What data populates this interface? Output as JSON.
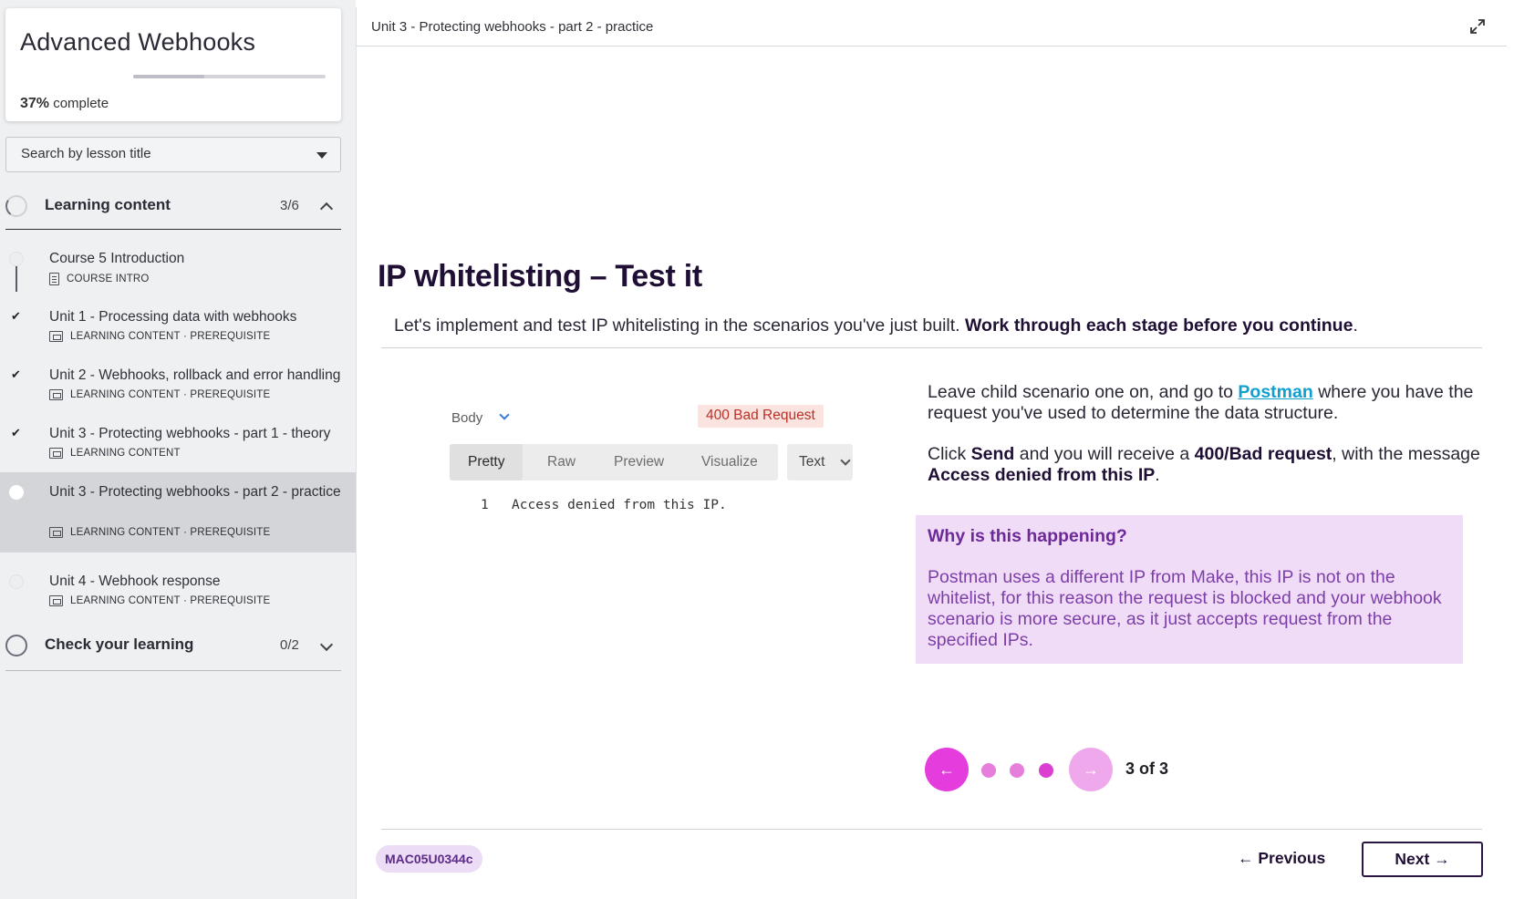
{
  "sidebar": {
    "course_title": "Advanced Webhooks",
    "progress_percent": "37%",
    "progress_suffix": "complete",
    "progress_fraction": 0.37,
    "search_placeholder": "Search by lesson title",
    "sections": [
      {
        "title": "Learning content",
        "count": "3/6",
        "expanded": true
      },
      {
        "title": "Check your learning",
        "count": "0/2",
        "expanded": false
      }
    ],
    "lessons": [
      {
        "title": "Course 5 Introduction",
        "meta": "COURSE INTRO",
        "done": false
      },
      {
        "title": "Unit 1 - Processing data with webhooks",
        "meta": "LEARNING CONTENT · PREREQUISITE",
        "done": true
      },
      {
        "title": "Unit 2 - Webhooks, rollback and error handling",
        "meta": "LEARNING CONTENT · PREREQUISITE",
        "done": true
      },
      {
        "title": "Unit 3 - Protecting webhooks - part 1 - theory",
        "meta": "LEARNING CONTENT",
        "done": true
      },
      {
        "title": "Unit 3 - Protecting webhooks - part 2 - practice",
        "meta": "LEARNING CONTENT · PREREQUISITE",
        "done": false,
        "active": true
      },
      {
        "title": "Unit 4 - Webhook response",
        "meta": "LEARNING CONTENT · PREREQUISITE",
        "done": false
      }
    ],
    "check_icon": "✔"
  },
  "main": {
    "header_title": "Unit 3 - Protecting webhooks - part 2 - practice",
    "slide_title": "IP whitelisting – Test it",
    "intro_plain": "Let's implement and test IP whitelisting in the scenarios you've just built. ",
    "intro_bold": "Work through each stage before you continue",
    "intro_end": ".",
    "postman": {
      "body_label": "Body",
      "status": "400 Bad Request",
      "tabs": [
        "Pretty",
        "Raw",
        "Preview",
        "Visualize"
      ],
      "type": "Text",
      "line_num": "1",
      "line_text": "Access denied from this IP."
    },
    "para1_a": "Leave child scenario one on, and go to ",
    "para1_link": "Postman",
    "para1_b": " where you have the request you've used to determine the data structure.",
    "para2_a": "Click ",
    "para2_send": "Send",
    "para2_b": " and you will receive a ",
    "para2_status": "400/Bad request",
    "para2_c": ", with the message ",
    "para2_msg": "Access denied from this IP",
    "para2_end": ".",
    "callout_title": "Why is this happening?",
    "callout_body": "Postman uses a different IP from Make, this IP is not on the whitelist, for this reason the request is blocked and your webhook scenario is more secure, as it just accepts request from the specified IPs.",
    "carousel": {
      "count_label": "3 of 3",
      "prev_icon": "←",
      "next_icon": "→"
    },
    "code_badge": "MAC05U0344c",
    "prev_label": "← Previous",
    "next_label": "Next →"
  },
  "colors": {
    "accent_pink": "#e53ddd",
    "callout_bg": "#f1dcf7",
    "link": "#10a0cf",
    "heading": "#1f0f34"
  }
}
